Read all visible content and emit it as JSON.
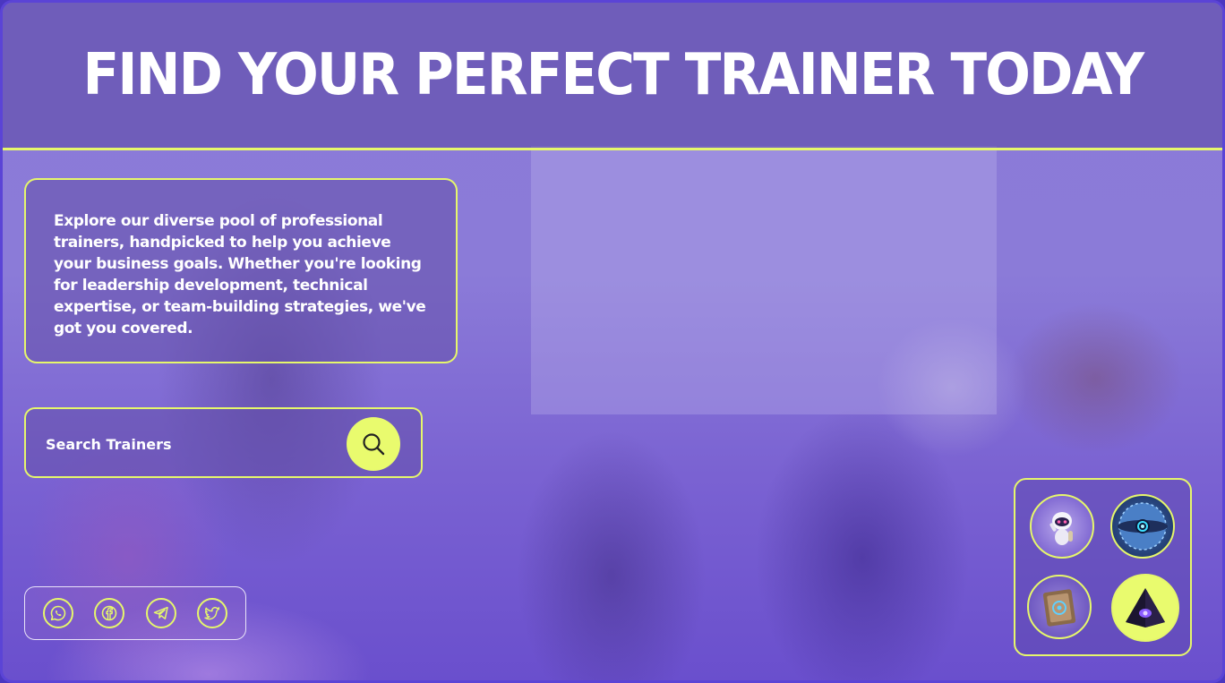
{
  "header": {
    "title": "FIND YOUR PERFECT TRAINER TODAY"
  },
  "description": {
    "text": "Explore our diverse pool of professional trainers, handpicked to help you achieve your business goals. Whether you're looking for leadership development, technical expertise, or team-building strategies, we've got you covered."
  },
  "search": {
    "placeholder": "Search Trainers",
    "icon": "search-icon"
  },
  "social": {
    "items": [
      {
        "name": "whatsapp",
        "icon": "whatsapp-icon"
      },
      {
        "name": "facebook",
        "icon": "facebook-icon"
      },
      {
        "name": "telegram",
        "icon": "telegram-icon"
      },
      {
        "name": "twitter",
        "icon": "twitter-icon"
      }
    ]
  },
  "avatars": {
    "items": [
      {
        "name": "robot",
        "icon": "robot-avatar"
      },
      {
        "name": "orb",
        "icon": "orb-avatar"
      },
      {
        "name": "book",
        "icon": "book-avatar"
      },
      {
        "name": "pyramid",
        "icon": "pyramid-avatar",
        "selected": true
      }
    ]
  },
  "colors": {
    "accent": "#e6f76b",
    "overlay": "#6a4fcd",
    "text": "#ffffff"
  }
}
